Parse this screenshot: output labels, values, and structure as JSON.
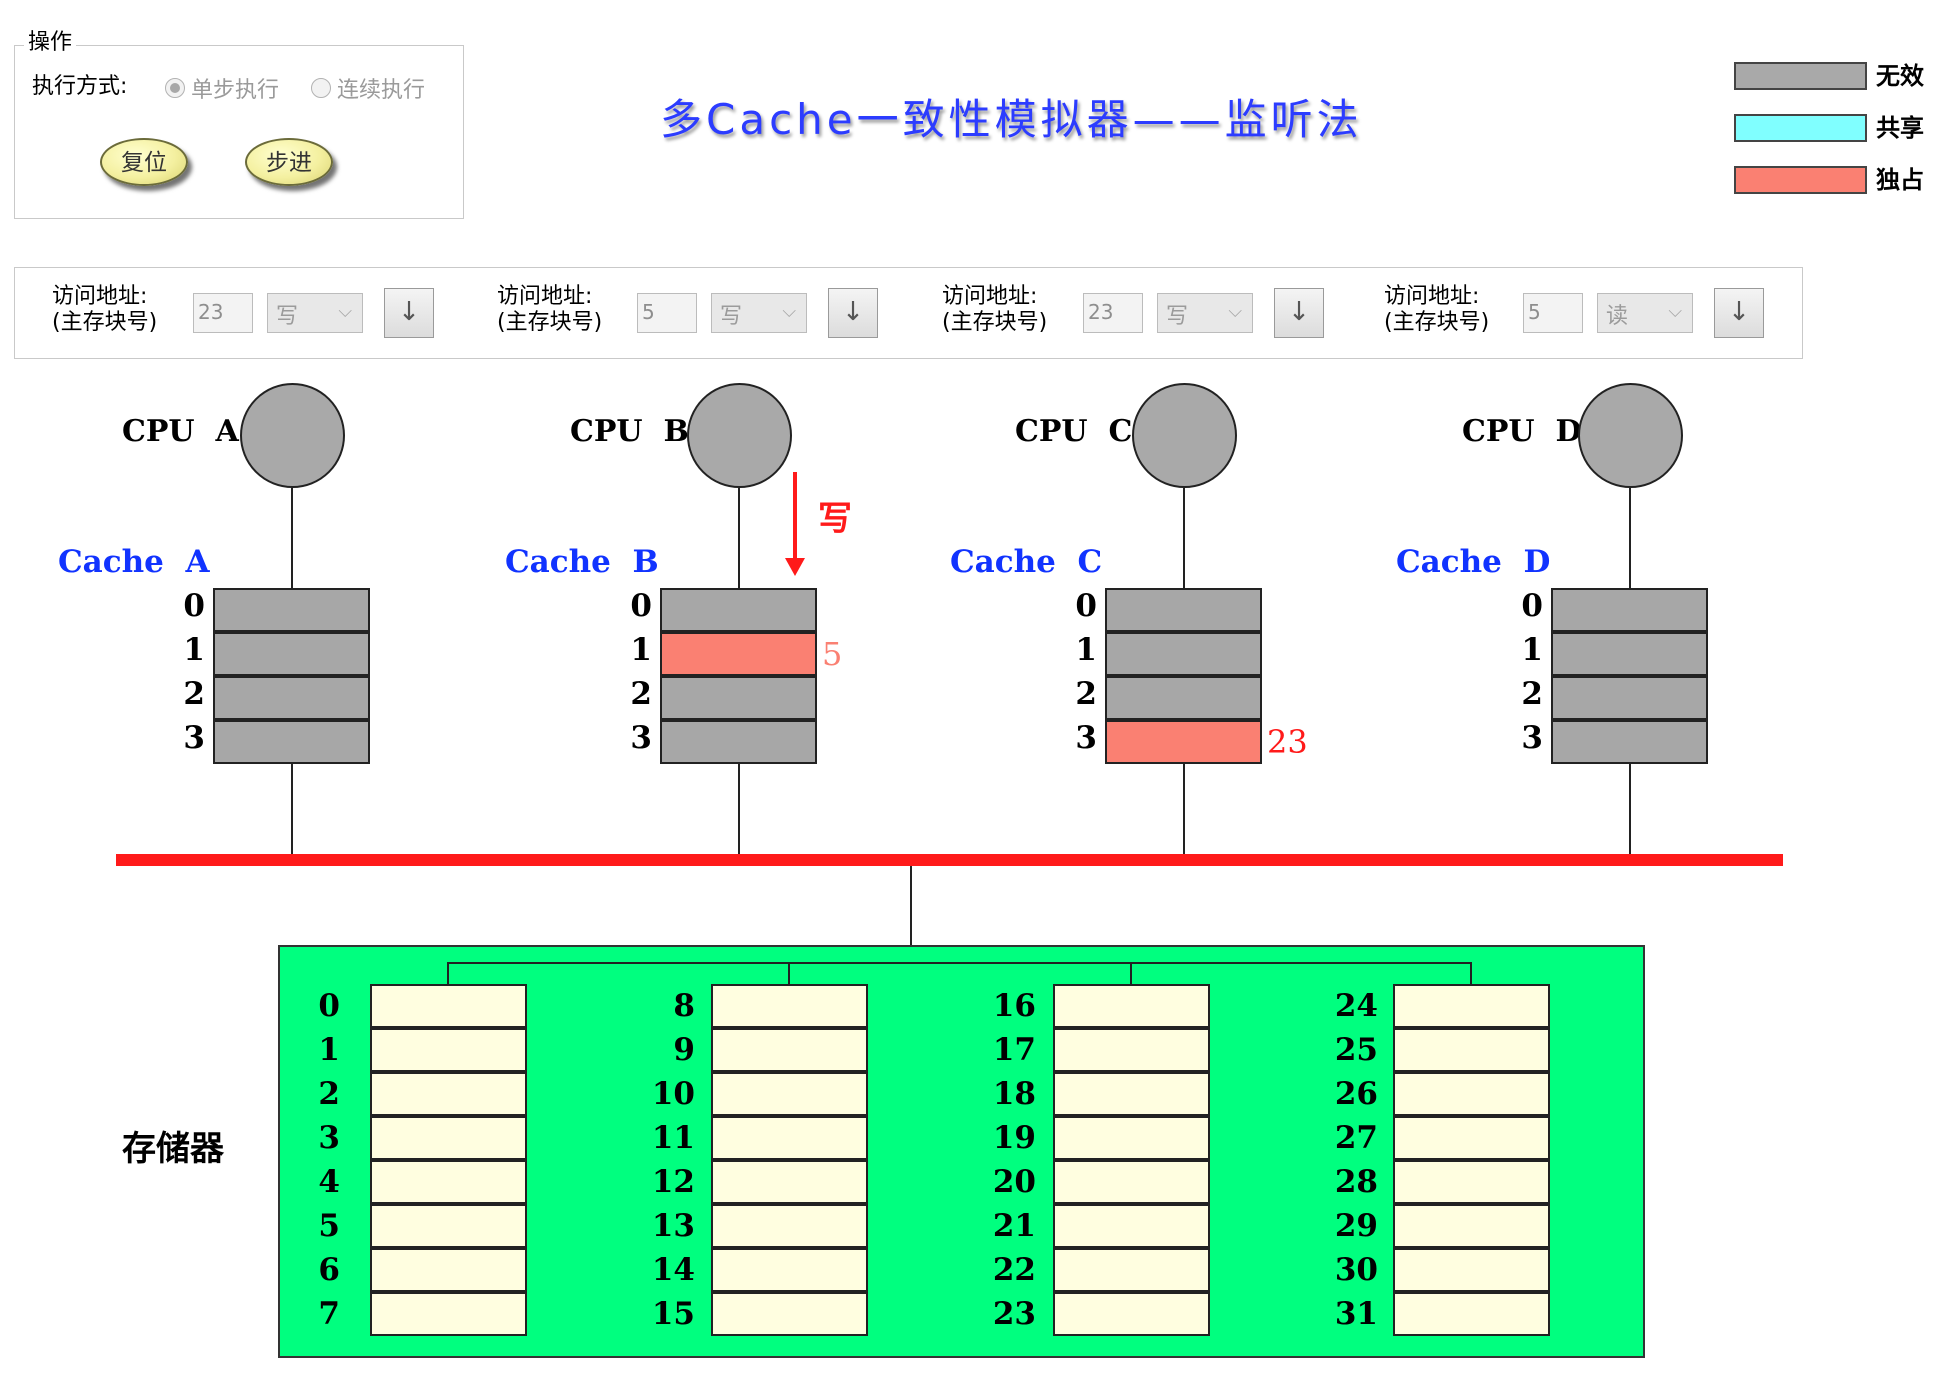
{
  "title": "多Cache一致性模拟器——监听法",
  "operation": {
    "group_title": "操作",
    "mode_label": "执行方式:",
    "modes": [
      {
        "label": "单步执行",
        "selected": true
      },
      {
        "label": "连续执行",
        "selected": false
      }
    ],
    "reset_label": "复位",
    "step_label": "步进"
  },
  "legend": [
    {
      "label": "无效",
      "color": "#a9a9a9"
    },
    {
      "label": "共享",
      "color": "#80ffff"
    },
    {
      "label": "独占",
      "color": "#fa8072"
    }
  ],
  "access_controls": [
    {
      "label_line1": "访问地址:",
      "label_line2": "(主存块号)",
      "address": "23",
      "operation": "写",
      "go_icon": "down-arrow-icon"
    },
    {
      "label_line1": "访问地址:",
      "label_line2": "(主存块号)",
      "address": "5",
      "operation": "写",
      "go_icon": "down-arrow-icon"
    },
    {
      "label_line1": "访问地址:",
      "label_line2": "(主存块号)",
      "address": "23",
      "operation": "写",
      "go_icon": "down-arrow-icon"
    },
    {
      "label_line1": "访问地址:",
      "label_line2": "(主存块号)",
      "address": "5",
      "operation": "读",
      "go_icon": "down-arrow-icon"
    }
  ],
  "cpus": [
    {
      "cpu_label": "CPU  A",
      "cache_label": "Cache  A",
      "lines": [
        {
          "index": "0",
          "state": "invalid",
          "tag": ""
        },
        {
          "index": "1",
          "state": "invalid",
          "tag": ""
        },
        {
          "index": "2",
          "state": "invalid",
          "tag": ""
        },
        {
          "index": "3",
          "state": "invalid",
          "tag": ""
        }
      ]
    },
    {
      "cpu_label": "CPU  B",
      "cache_label": "Cache  B",
      "lines": [
        {
          "index": "0",
          "state": "invalid",
          "tag": ""
        },
        {
          "index": "1",
          "state": "exclusive",
          "tag": "5",
          "tag_color": "#fa8072"
        },
        {
          "index": "2",
          "state": "invalid",
          "tag": ""
        },
        {
          "index": "3",
          "state": "invalid",
          "tag": ""
        }
      ]
    },
    {
      "cpu_label": "CPU  C",
      "cache_label": "Cache  C",
      "lines": [
        {
          "index": "0",
          "state": "invalid",
          "tag": ""
        },
        {
          "index": "1",
          "state": "invalid",
          "tag": ""
        },
        {
          "index": "2",
          "state": "invalid",
          "tag": ""
        },
        {
          "index": "3",
          "state": "exclusive",
          "tag": "23",
          "tag_color": "#ff1a1a"
        }
      ]
    },
    {
      "cpu_label": "CPU  D",
      "cache_label": "Cache  D",
      "lines": [
        {
          "index": "0",
          "state": "invalid",
          "tag": ""
        },
        {
          "index": "1",
          "state": "invalid",
          "tag": ""
        },
        {
          "index": "2",
          "state": "invalid",
          "tag": ""
        },
        {
          "index": "3",
          "state": "invalid",
          "tag": ""
        }
      ]
    }
  ],
  "bus_indicator": {
    "label": "写",
    "cpu": "CPU  B",
    "color": "#ff1a1a"
  },
  "memory": {
    "label": "存储器",
    "columns": [
      [
        "0",
        "1",
        "2",
        "3",
        "4",
        "5",
        "6",
        "7"
      ],
      [
        "8",
        "9",
        "10",
        "11",
        "12",
        "13",
        "14",
        "15"
      ],
      [
        "16",
        "17",
        "18",
        "19",
        "20",
        "21",
        "22",
        "23"
      ],
      [
        "24",
        "25",
        "26",
        "27",
        "28",
        "29",
        "30",
        "31"
      ]
    ]
  },
  "colors": {
    "bus": "#ff1a1a",
    "memory_bg": "#00ff7f",
    "cell_bg": "#fffee0",
    "title": "#2c3cff",
    "cache_label": "#1133ff"
  }
}
